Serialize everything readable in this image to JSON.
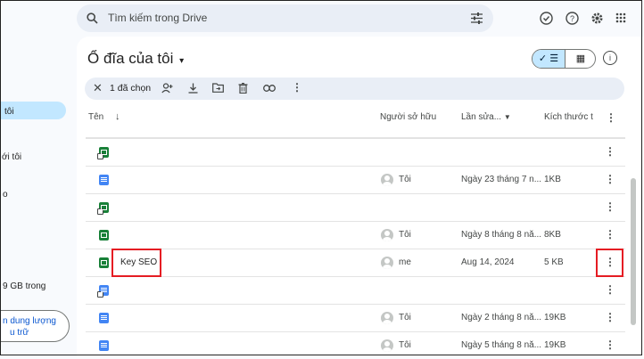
{
  "sidebar": {
    "items": [
      {
        "label": "tôi"
      },
      {
        "label": "ới tôi"
      },
      {
        "label": "o"
      }
    ],
    "storage_text": "9 GB trong",
    "storage_button": [
      "n dung lượng",
      "u trữ"
    ]
  },
  "search": {
    "placeholder": "Tìm kiếm trong Drive",
    "icon": "search-icon",
    "filter_icon": "tune-icon"
  },
  "top_icons": [
    "offline-ready-icon",
    "help-icon",
    "settings-icon",
    "apps-icon"
  ],
  "title": "Ổ đĩa của tôi",
  "view_toggle": {
    "list": "✓ ☰",
    "grid": "▦"
  },
  "selection": {
    "label": "1 đã chọn"
  },
  "columns": {
    "name": "Tên",
    "owner": "Người sở hữu",
    "modified": "Lần sửa...",
    "size": "Kích thước t"
  },
  "files": [
    {
      "type": "sheet",
      "shortcut": true,
      "name": "",
      "owner": "",
      "modified": "",
      "size": ""
    },
    {
      "type": "doc",
      "shortcut": false,
      "name": "",
      "owner": "Tôi",
      "modified": "Ngày 23 tháng 7 n...",
      "size": "1KB"
    },
    {
      "type": "sheet",
      "shortcut": true,
      "name": "",
      "owner": "",
      "modified": "",
      "size": ""
    },
    {
      "type": "sheet",
      "shortcut": false,
      "name": "",
      "owner": "Tôi",
      "modified": "Ngày 8 tháng 8 nă...",
      "size": "8KB"
    },
    {
      "type": "sheet",
      "shortcut": false,
      "name": "Key SEO",
      "owner": "me",
      "modified": "Aug 14, 2024",
      "size": "5 KB"
    },
    {
      "type": "doc",
      "shortcut": true,
      "name": "",
      "owner": "",
      "modified": "",
      "size": ""
    },
    {
      "type": "doc",
      "shortcut": false,
      "name": "",
      "owner": "Tôi",
      "modified": "Ngày 2 tháng 8 nă...",
      "size": "19KB"
    },
    {
      "type": "doc",
      "shortcut": false,
      "name": "",
      "owner": "Tôi",
      "modified": "Ngày 5 tháng 8 nă...",
      "size": "19KB"
    }
  ],
  "colors": {
    "accent": "#c2e7ff",
    "highlight": "#e51c23",
    "sheet": "#188038",
    "doc": "#4285f4"
  }
}
